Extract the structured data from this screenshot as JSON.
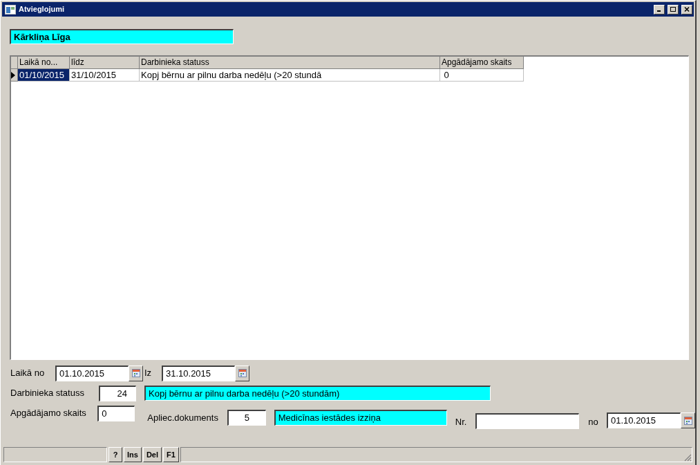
{
  "window": {
    "title": "Atvieglojumi"
  },
  "employee_name": "Kārkliņa Līga",
  "table": {
    "columns": [
      "Laikā no...",
      "līdz",
      "Darbinieka statuss",
      "Apgādājamo skaits"
    ],
    "rows": [
      {
        "selected": true,
        "cells": [
          "01/10/2015",
          "31/10/2015",
          "Kopj bērnu ar pilnu darba nedēļu (>20 stundā",
          " 0"
        ]
      }
    ]
  },
  "form": {
    "period_label": "Laikā no",
    "period_from": "01.10.2015",
    "period_to_label": "Iz",
    "period_to": "31.10.2015",
    "status_label": "Darbinieka statuss",
    "status_code": "24",
    "status_name": "Kopj bērnu ar pilnu darba nedēļu (>20 stundām)",
    "dependents_label": "Apgādājamo skaits",
    "dependents": "0",
    "document_label": "Apliec.dokuments",
    "document_code": "5",
    "document_name": "Medicīnas iestādes izziņa",
    "number_label": "Nr.",
    "date_label": "no",
    "date": "01.10.2015"
  },
  "status_bar": {
    "buttons": [
      "?",
      "Ins",
      "Del",
      "F1"
    ]
  }
}
